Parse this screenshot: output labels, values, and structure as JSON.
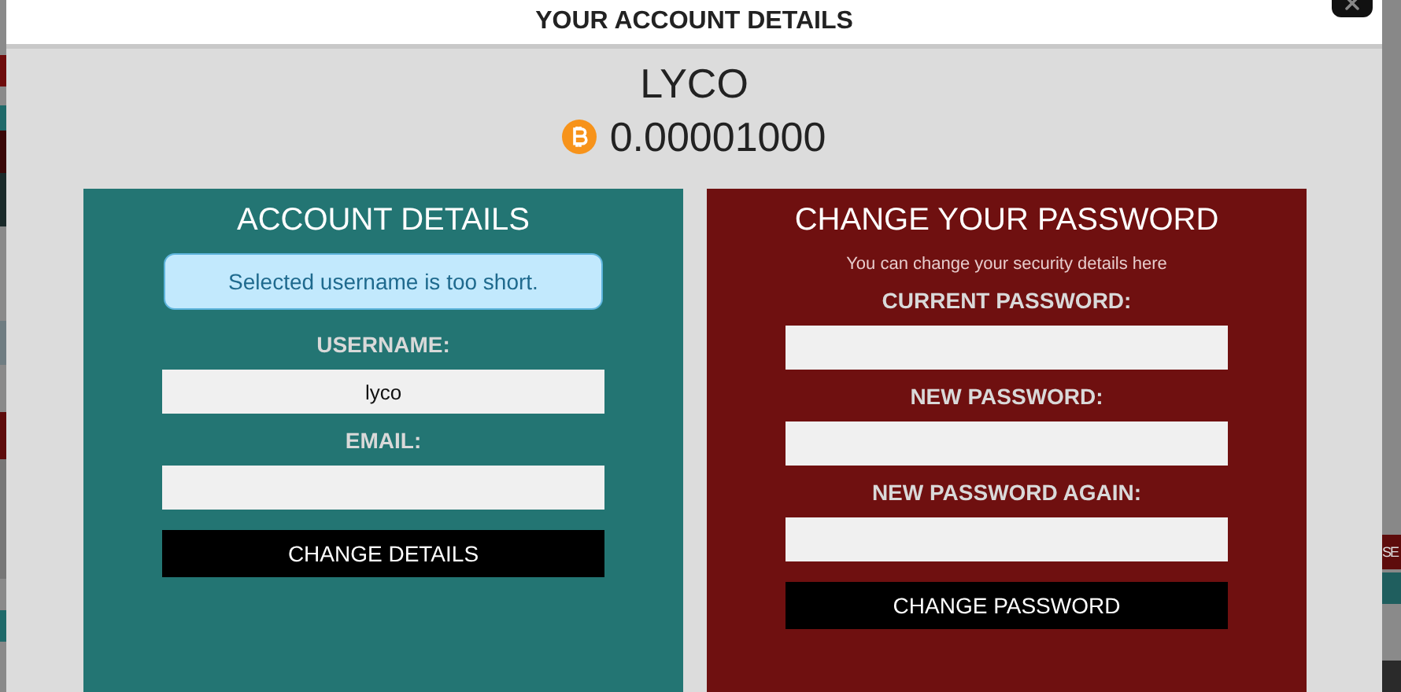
{
  "window": {
    "title": "YOUR ACCOUNT DETAILS"
  },
  "account": {
    "name": "LYCO",
    "balance": "0.00001000"
  },
  "details": {
    "title": "ACCOUNT DETAILS",
    "alert": "Selected username is too short.",
    "button": "CHANGE DETAILS",
    "fields": [
      {
        "label": "USERNAME:",
        "value": "lyco"
      },
      {
        "label": "EMAIL:"
      }
    ]
  },
  "password": {
    "title": "CHANGE YOUR PASSWORD",
    "subtitle": "You can change your security details here",
    "button": "CHANGE PASSWORD",
    "fields": [
      {
        "label": "CURRENT PASSWORD:"
      },
      {
        "label": "NEW PASSWORD:"
      },
      {
        "label": "NEW PASSWORD AGAIN:"
      }
    ]
  },
  "background": {
    "button": "SE"
  }
}
